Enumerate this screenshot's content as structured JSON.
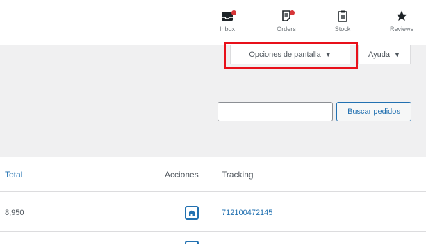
{
  "activity_bar": {
    "items": [
      {
        "label": "Inbox",
        "icon": "inbox-icon",
        "badge": true
      },
      {
        "label": "Orders",
        "icon": "orders-icon",
        "badge": true
      },
      {
        "label": "Stock",
        "icon": "stock-icon",
        "badge": false
      },
      {
        "label": "Reviews",
        "icon": "reviews-icon",
        "badge": false
      }
    ]
  },
  "tabs": {
    "screen_options": "Opciones de pantalla",
    "help": "Ayuda",
    "arrow": "▼"
  },
  "search": {
    "value": "",
    "placeholder": "",
    "button_label": "Buscar pedidos"
  },
  "table": {
    "columns": {
      "total": "Total",
      "actions": "Acciones",
      "tracking": "Tracking"
    },
    "rows": [
      {
        "total": "8,950",
        "tracking": "712100472145"
      }
    ]
  },
  "colors": {
    "accent": "#2271b1",
    "badge": "#d63638",
    "highlight": "#e8101a"
  }
}
